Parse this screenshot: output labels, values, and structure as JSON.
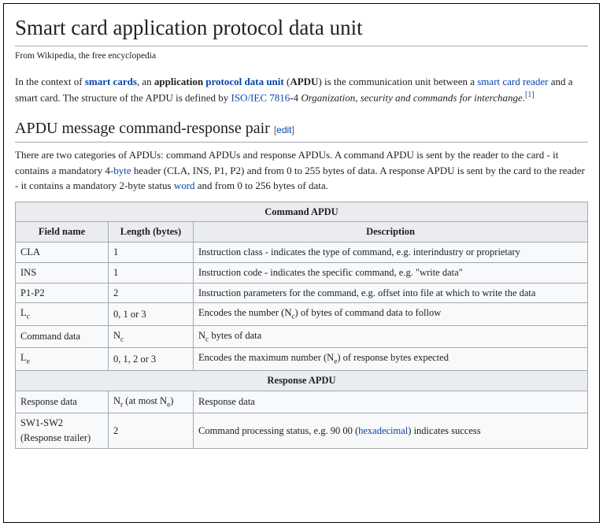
{
  "title": "Smart card application protocol data unit",
  "subtitle": "From Wikipedia, the free encyclopedia",
  "intro": {
    "pre": "In the context of ",
    "link1": "smart cards",
    "mid1": ", an ",
    "bold1a": "application ",
    "bold_link": "protocol data unit",
    "mid2": " (",
    "bold2": "APDU",
    "mid3": ") is the communication unit between a ",
    "link2": "smart card reader",
    "mid4": " and a smart card. The structure of the APDU is defined by ",
    "link3": "ISO/IEC 7816",
    "mid5": "-4 ",
    "ital": "Organization, security and commands for interchange",
    "dot": ".",
    "ref": "[1]"
  },
  "section1": {
    "heading": "APDU message command-response pair",
    "edit_open": "[",
    "edit": "edit",
    "edit_close": "]",
    "p_a": "There are two categories of APDUs: command APDUs and response APDUs. A command APDU is sent by the reader to the card - it contains a mandatory 4-",
    "p_link1": "byte",
    "p_b": " header (CLA, INS, P1, P2) and from 0 to 255 bytes of data. A response APDU is sent by the card to the reader - it contains a mandatory 2-byte status ",
    "p_link2": "word",
    "p_c": " and from 0 to 256 bytes of data."
  },
  "table": {
    "cmd_header": "Command APDU",
    "col1": "Field name",
    "col2": "Length (bytes)",
    "col3": "Description",
    "rows_cmd": [
      {
        "f": "CLA",
        "l": "1",
        "d": "Instruction class - indicates the type of command, e.g. interindustry or proprietary"
      },
      {
        "f": "INS",
        "l": "1",
        "d": "Instruction code - indicates the specific command, e.g. \"write data\""
      },
      {
        "f": "P1-P2",
        "l": "2",
        "d": "Instruction parameters for the command, e.g. offset into file at which to write the data"
      }
    ],
    "lc": {
      "f_a": "L",
      "f_sub": "c",
      "l": "0, 1 or 3",
      "d_a": "Encodes the number (N",
      "d_sub": "c",
      "d_b": ") of bytes of command data to follow"
    },
    "cd": {
      "f": "Command data",
      "l_a": "N",
      "l_sub": "c",
      "d_a": "N",
      "d_sub": "c",
      "d_b": " bytes of data"
    },
    "le": {
      "f_a": "L",
      "f_sub": "e",
      "l": "0, 1, 2 or 3",
      "d_a": "Encodes the maximum number (N",
      "d_sub": "e",
      "d_b": ") of response bytes expected"
    },
    "resp_header": "Response APDU",
    "rd": {
      "f": "Response data",
      "l_a": "N",
      "l_sub": "r",
      "l_b": " (at most N",
      "l_sub2": "e",
      "l_c": ")",
      "d": "Response data"
    },
    "sw": {
      "f": "SW1-SW2 (Response trailer)",
      "l": "2",
      "d_a": "Command processing status, e.g. 90 00 (",
      "d_link": "hexadecimal",
      "d_b": ") indicates success"
    }
  }
}
